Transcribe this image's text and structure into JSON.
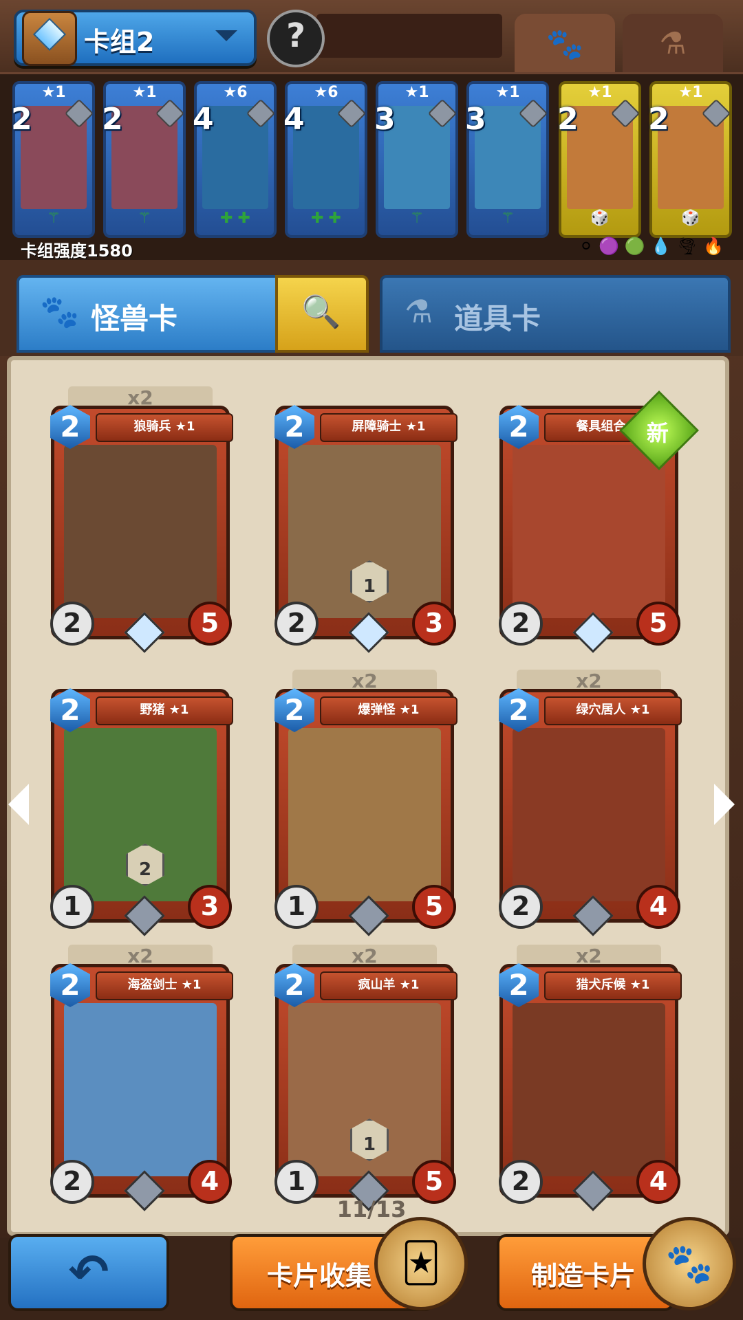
{
  "header": {
    "deck_name": "卡组2",
    "profile_icon": "question-mark",
    "tabs": [
      {
        "icon": "🐾",
        "name": "paw"
      },
      {
        "icon": "⚗",
        "name": "potion"
      }
    ]
  },
  "deck": {
    "power_label": "卡组强度1580",
    "cards": [
      {
        "star": "★1",
        "cost": "2",
        "style": "blue",
        "art": "#8a4a5a",
        "icon": "wand"
      },
      {
        "star": "★1",
        "cost": "2",
        "style": "blue",
        "art": "#8a4a5a",
        "icon": "wand"
      },
      {
        "star": "★6",
        "cost": "4",
        "style": "blue",
        "art": "#2a6ca0",
        "icon": "plus"
      },
      {
        "star": "★6",
        "cost": "4",
        "style": "blue",
        "art": "#2a6ca0",
        "icon": "plus"
      },
      {
        "star": "★1",
        "cost": "3",
        "style": "blue",
        "art": "#3d87b8",
        "icon": "wand"
      },
      {
        "star": "★1",
        "cost": "3",
        "style": "blue",
        "art": "#3d87b8",
        "icon": "wand"
      },
      {
        "star": "★1",
        "cost": "2",
        "style": "gold",
        "art": "#c27a3a",
        "icon": "dice"
      },
      {
        "star": "★1",
        "cost": "2",
        "style": "gold",
        "art": "#c27a3a",
        "icon": "dice"
      }
    ],
    "element_icons": [
      "⚪",
      "🟣",
      "🟢",
      "💧",
      "🌪",
      "🔥"
    ]
  },
  "categories": {
    "monster_label": "怪兽卡",
    "item_label": "道具卡",
    "search_icon": "🔍"
  },
  "cards": [
    {
      "name": "狼骑兵 ★1",
      "cost": "2",
      "atk": "2",
      "hp": "5",
      "dup": "x2",
      "art": "#6b4a33",
      "gem": "ice",
      "badge": "",
      "isNew": false
    },
    {
      "name": "屏障骑士 ★1",
      "cost": "2",
      "atk": "2",
      "hp": "3",
      "dup": "",
      "art": "#8a6b4a",
      "gem": "ice",
      "badge": "1",
      "isNew": false
    },
    {
      "name": "餐具组合 ★1",
      "cost": "2",
      "atk": "2",
      "hp": "5",
      "dup": "",
      "art": "#a8472e",
      "gem": "ice",
      "badge": "",
      "isNew": true
    },
    {
      "name": "野猪 ★1",
      "cost": "2",
      "atk": "1",
      "hp": "3",
      "dup": "",
      "art": "#4f7a3a",
      "gem": "plain",
      "badge": "2",
      "isNew": false
    },
    {
      "name": "爆弹怪 ★1",
      "cost": "2",
      "atk": "1",
      "hp": "5",
      "dup": "x2",
      "art": "#a07848",
      "gem": "plain",
      "badge": "",
      "isNew": false
    },
    {
      "name": "绿穴居人 ★1",
      "cost": "2",
      "atk": "2",
      "hp": "4",
      "dup": "x2",
      "art": "#8a3a24",
      "gem": "plain",
      "badge": "",
      "isNew": false
    },
    {
      "name": "海盗剑士 ★1",
      "cost": "2",
      "atk": "2",
      "hp": "4",
      "dup": "x2",
      "art": "#5b8ec0",
      "gem": "plain",
      "badge": "",
      "isNew": false
    },
    {
      "name": "疯山羊 ★1",
      "cost": "2",
      "atk": "1",
      "hp": "5",
      "dup": "x2",
      "art": "#9a6a48",
      "gem": "plain",
      "badge": "1",
      "isNew": false
    },
    {
      "name": "猎犬斥候 ★1",
      "cost": "2",
      "atk": "2",
      "hp": "4",
      "dup": "x2",
      "art": "#7a3a24",
      "gem": "plain",
      "badge": "",
      "isNew": false
    }
  ],
  "new_label": "新",
  "pagination": {
    "text": "11/13"
  },
  "buttons": {
    "back_icon": "↶",
    "collect_label": "卡片收集",
    "craft_label": "制造卡片"
  }
}
